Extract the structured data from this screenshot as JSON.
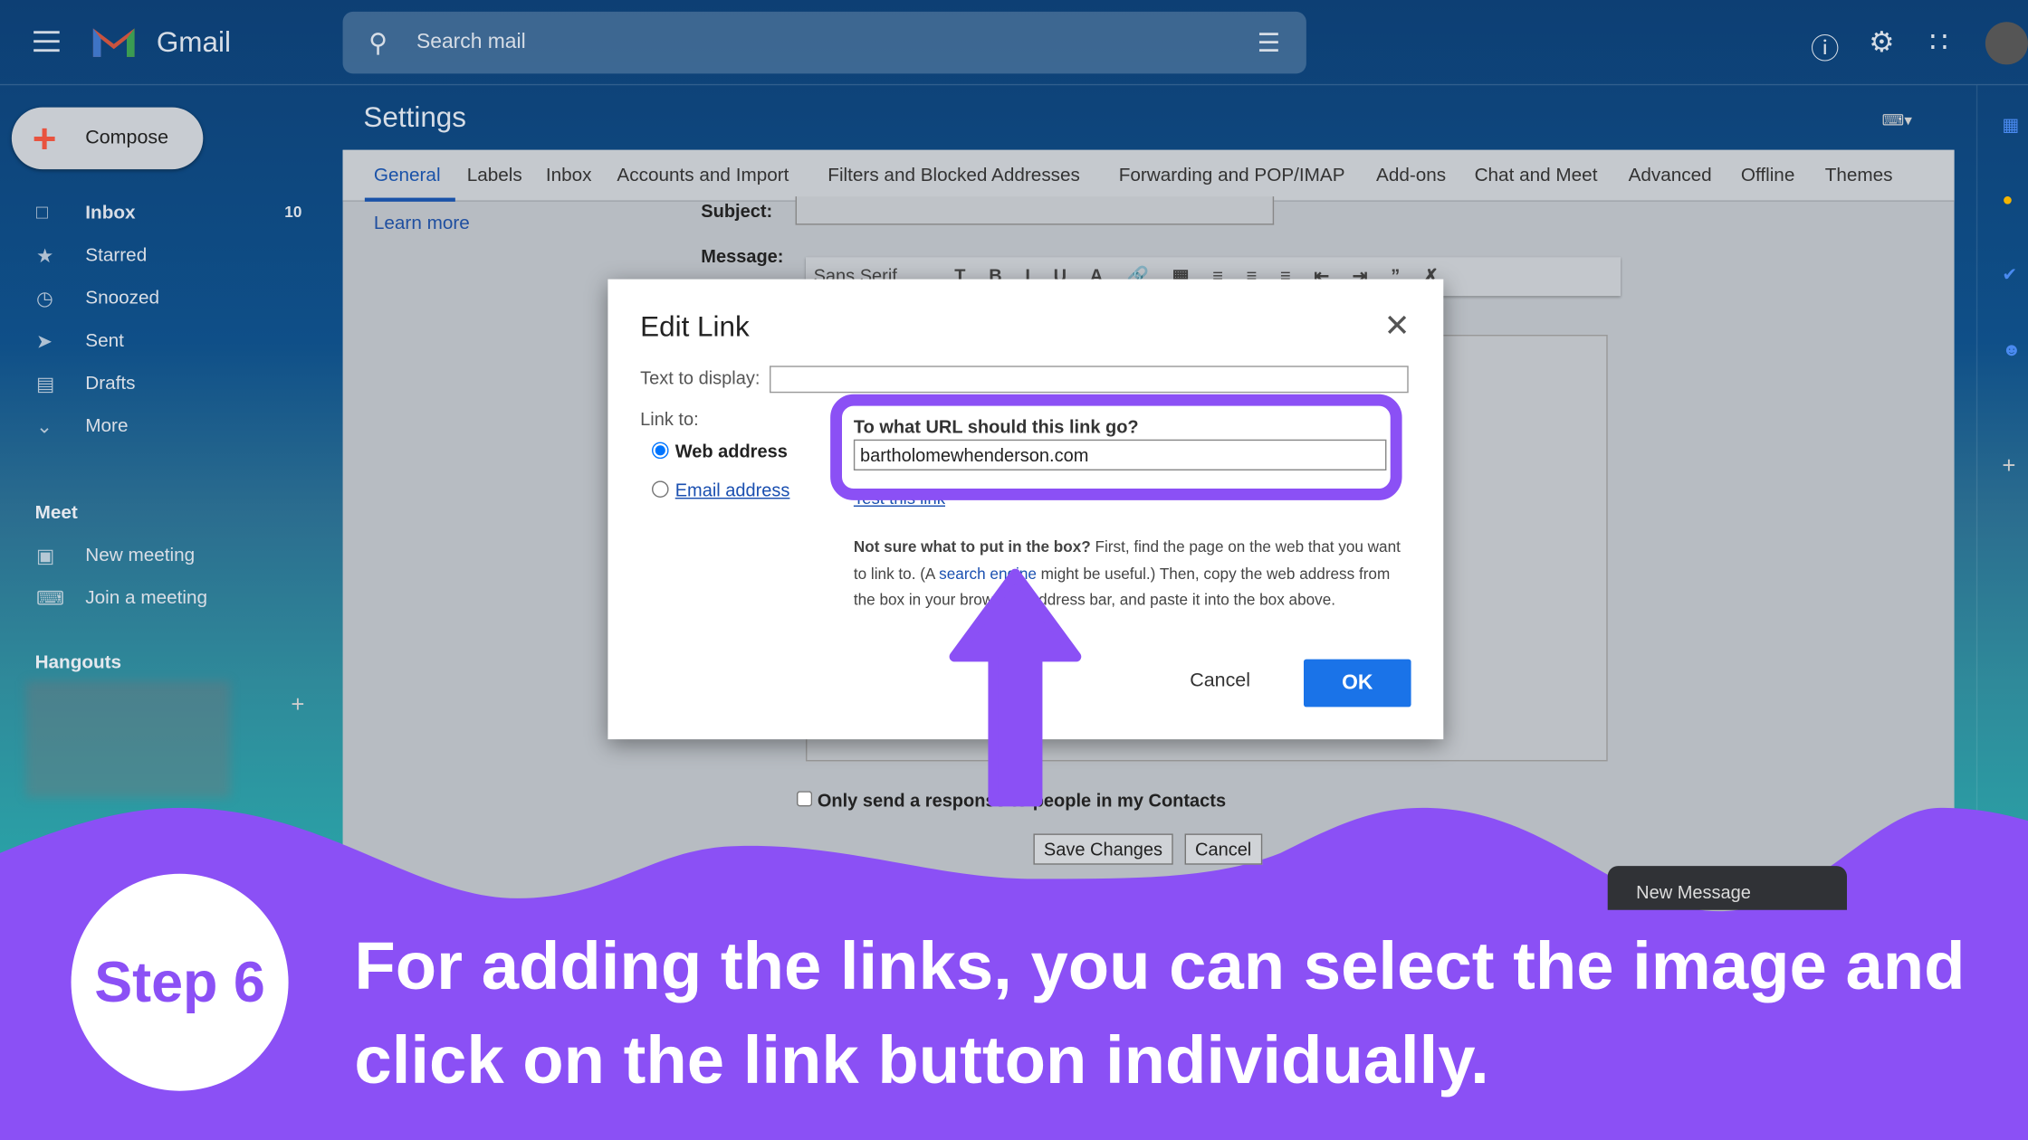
{
  "header": {
    "brand": "Gmail",
    "search_placeholder": "Search mail"
  },
  "sidebar": {
    "compose": "Compose",
    "items": [
      {
        "label": "Inbox",
        "count": "10",
        "icon": "inbox-icon"
      },
      {
        "label": "Starred",
        "icon": "star-icon"
      },
      {
        "label": "Snoozed",
        "icon": "clock-icon"
      },
      {
        "label": "Sent",
        "icon": "send-icon"
      },
      {
        "label": "Drafts",
        "icon": "draft-icon"
      },
      {
        "label": "More",
        "icon": "chevron-down-icon"
      }
    ],
    "meet_title": "Meet",
    "meet": [
      {
        "label": "New meeting"
      },
      {
        "label": "Join a meeting"
      }
    ],
    "hangouts_title": "Hangouts"
  },
  "settings": {
    "title": "Settings",
    "tabs": [
      "General",
      "Labels",
      "Inbox",
      "Accounts and Import",
      "Filters and Blocked Addresses",
      "Forwarding and POP/IMAP",
      "Add-ons",
      "Chat and Meet",
      "Advanced",
      "Offline",
      "Themes"
    ],
    "learn_more": "Learn more",
    "subject_label": "Subject:",
    "message_label": "Message:",
    "font": "Sans Serif",
    "contacts_check": "Only send a response to people in my Contacts",
    "save": "Save Changes",
    "cancel": "Cancel",
    "new_message": "New Message"
  },
  "dialog": {
    "title": "Edit Link",
    "text_label": "Text to display:",
    "text_value": "",
    "link_to": "Link to:",
    "web": "Web address",
    "email": "Email address",
    "url_question": "To what URL should this link go?",
    "url_value": "bartholomewhenderson.com",
    "test_link": "Test this link",
    "help_bold": "Not sure what to put in the box?",
    "help_1": " First, find the page on the web that you want to link to. (A ",
    "help_link": "search engine",
    "help_2": " might be useful.) Then, copy the web address from the box in your browser's address bar, and paste it into the box above.",
    "cancel": "Cancel",
    "ok": "OK"
  },
  "overlay": {
    "step": "Step 6",
    "caption": "For adding the links, you can select the image and click on the link button individually.",
    "accent": "#8b50f5"
  }
}
